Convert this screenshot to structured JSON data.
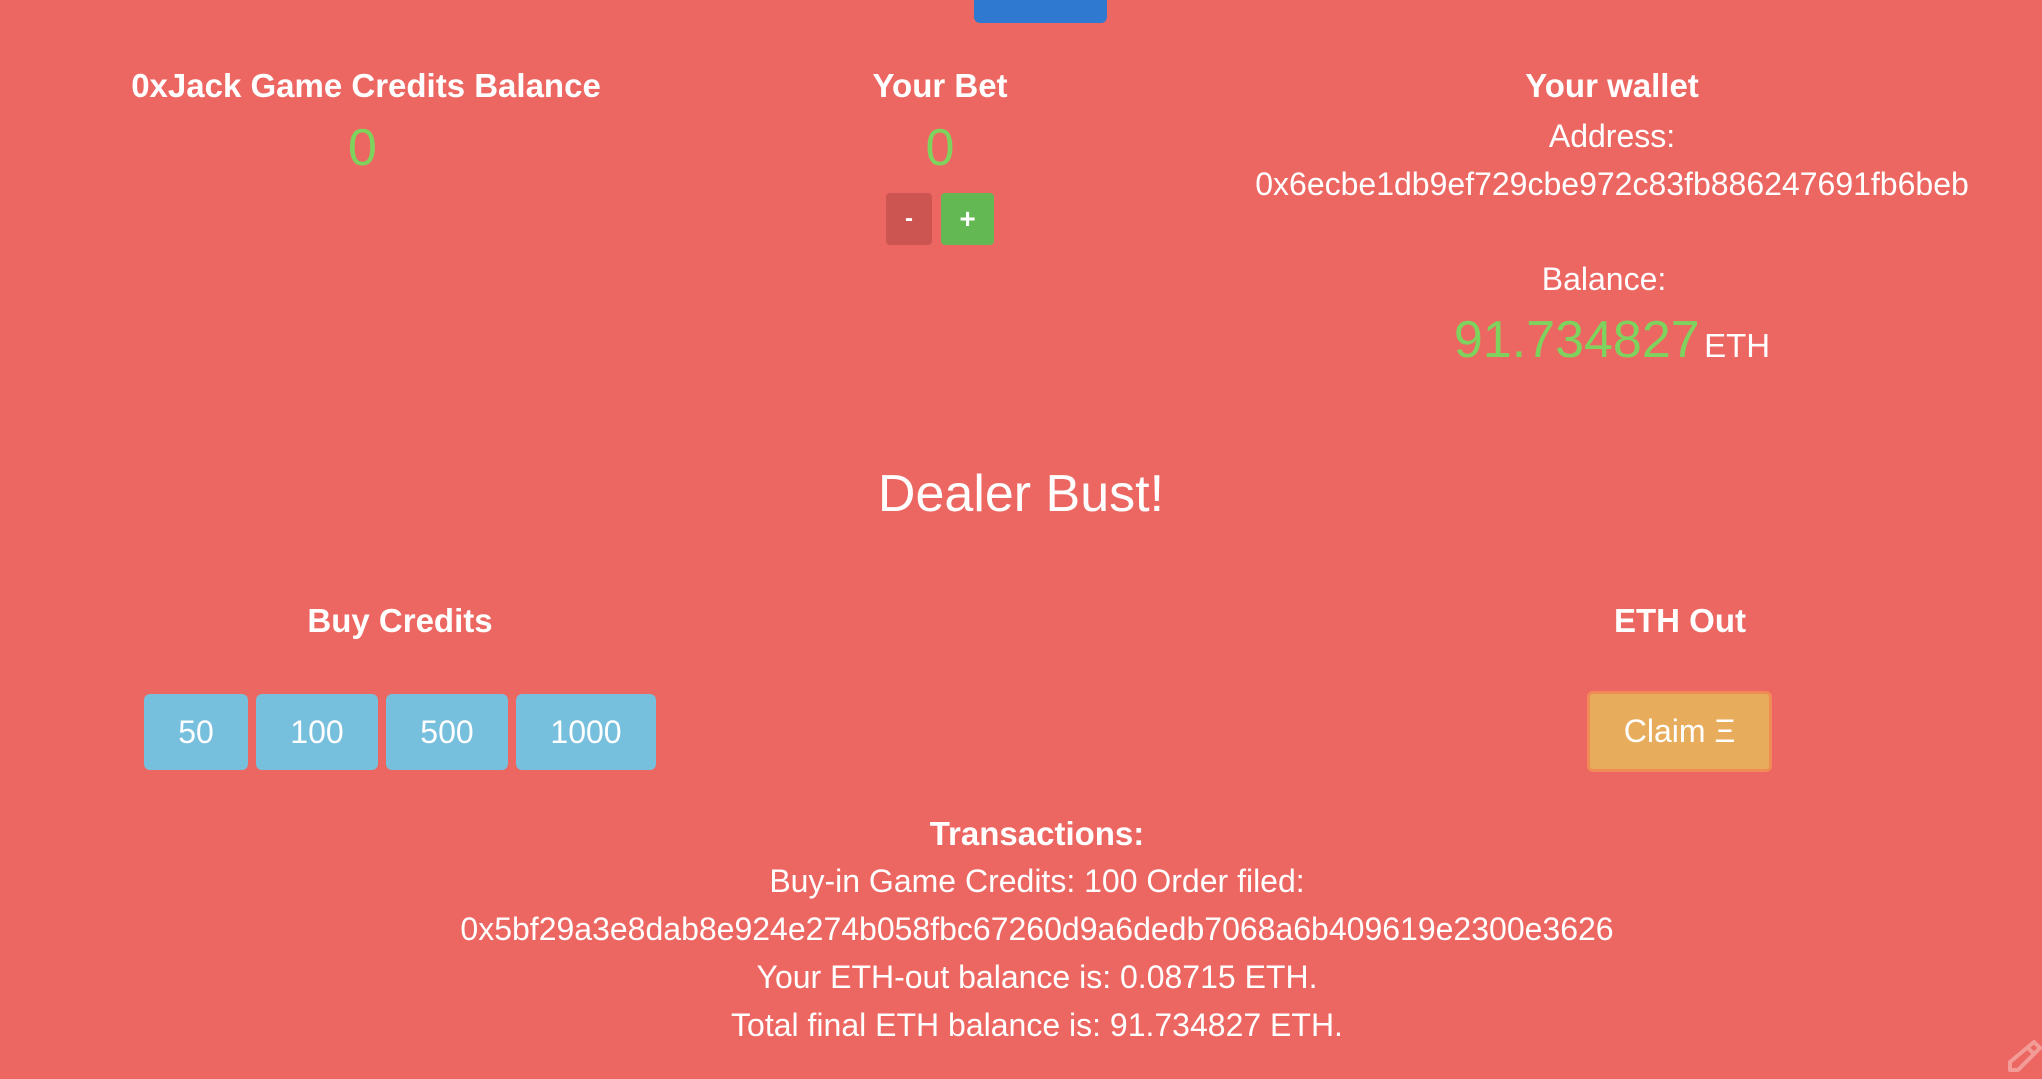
{
  "credits": {
    "title": "0xJack Game Credits Balance",
    "value": "0"
  },
  "bet": {
    "title": "Your Bet",
    "value": "0",
    "minus_label": "-",
    "plus_label": "+"
  },
  "wallet": {
    "title": "Your wallet",
    "address_label": "Address:",
    "address": "0x6ecbe1db9ef729cbe972c83fb886247691fb6beb",
    "balance_label": "Balance:",
    "balance_value": "91.734827",
    "balance_unit": "ETH"
  },
  "status_message": "Dealer Bust!",
  "buy_credits": {
    "title": "Buy Credits",
    "options": [
      "50",
      "100",
      "500",
      "1000"
    ]
  },
  "eth_out": {
    "title": "ETH Out",
    "claim_label": "Claim Ξ"
  },
  "transactions": {
    "title": "Transactions:",
    "lines": [
      "Buy-in Game Credits: 100 Order filed:",
      "0x5bf29a3e8dab8e924e274b058fbc67260d9a6dedb7068a6b409619e2300e3626",
      "Your ETH-out balance is: 0.08715 ETH.",
      "Total final ETH balance is: 91.734827 ETH."
    ]
  },
  "colors": {
    "background": "#ed6762",
    "accent_green": "#7ed35e",
    "credit_button": "#76bfdd",
    "claim_button": "#e8ad5c",
    "minus_button": "#cc5551",
    "plus_button": "#63b853",
    "top_button": "#2f7ad0"
  },
  "icons": {
    "corner": "pencil-icon"
  }
}
